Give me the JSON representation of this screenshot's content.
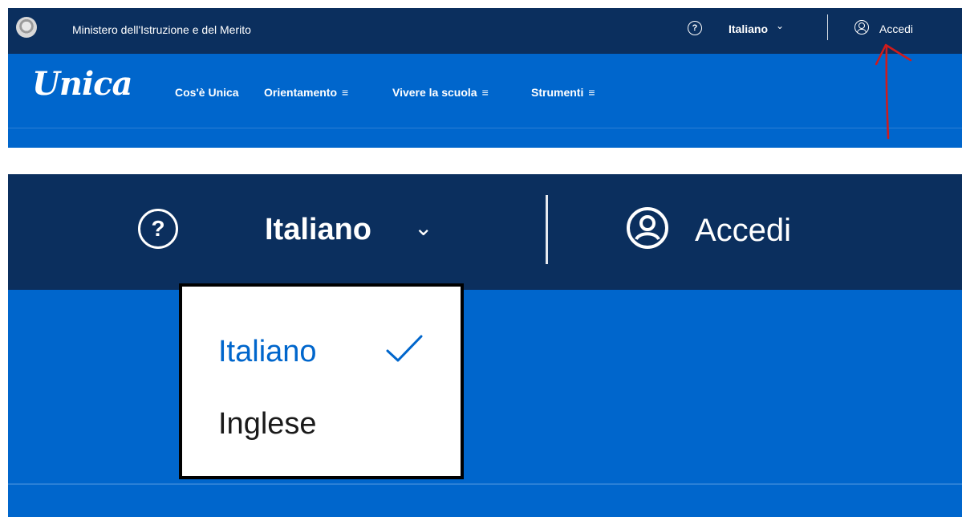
{
  "header": {
    "ministry_name": "Ministero dell'Istruzione e del Merito",
    "help_icon_glyph": "?",
    "language_label": "Italiano",
    "chevron_glyph": "⌄",
    "login_label": "Accedi"
  },
  "nav": {
    "logo_text": "Unica",
    "items": [
      {
        "label": "Cos'è Unica",
        "has_menu": false
      },
      {
        "label": "Orientamento",
        "has_menu": true
      },
      {
        "label": "Vivere la scuola",
        "has_menu": true
      },
      {
        "label": "Strumenti",
        "has_menu": true
      }
    ],
    "menu_glyph": "≡"
  },
  "language_dropdown": {
    "options": [
      {
        "label": "Italiano",
        "selected": true
      },
      {
        "label": "Inglese",
        "selected": false
      }
    ]
  },
  "colors": {
    "top_bar": "#0b2f5e",
    "nav_bar": "#0066cc",
    "selected_option": "#0066cc",
    "annotation": "#d01b1b"
  },
  "icons": [
    "emblem-icon",
    "help-icon",
    "chevron-down-icon",
    "user-icon",
    "menu-icon",
    "check-icon",
    "arrow-annotation"
  ]
}
